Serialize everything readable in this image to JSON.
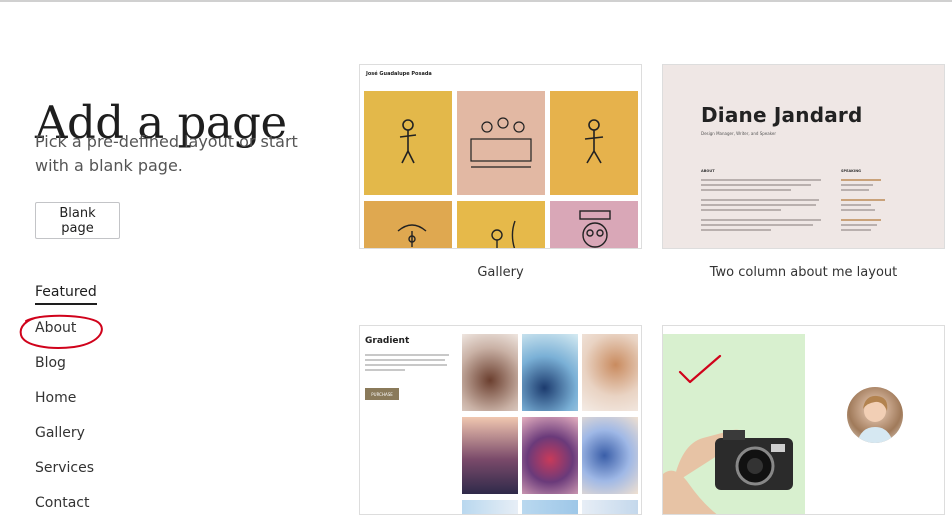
{
  "page": {
    "title": "Add a page",
    "subtitle": "Pick a pre-defined layout or start with a blank page.",
    "blank_page_label": "Blank page"
  },
  "categories": {
    "featured": "Featured",
    "items": [
      "About",
      "Blog",
      "Home",
      "Gallery",
      "Services",
      "Contact"
    ]
  },
  "layouts": [
    {
      "caption": "Gallery",
      "preview_title": "José Guadalupe Posada"
    },
    {
      "caption": "Two column about me layout",
      "preview_name": "Diane Jandard",
      "preview_role": "Design Manager, Writer, and Speaker",
      "about_heading": "ABOUT",
      "speaking_heading": "SPEAKING"
    },
    {
      "caption": "",
      "preview_title": "Gradient",
      "preview_button": "PURCHASE"
    },
    {
      "caption": ""
    }
  ],
  "colors": {
    "annotation": "#d0021b",
    "gallery_yellow": "#e3b84a",
    "gallery_pink": "#d9a7b7",
    "about_bg": "#efe7e5",
    "gradient_button": "#8a7a5a",
    "photo_green": "#d8f0cf"
  }
}
